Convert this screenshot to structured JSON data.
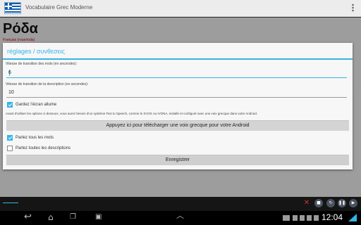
{
  "app": {
    "title": "Vocabulaire Grec Moderne",
    "word": "Ρόδα",
    "translation": "Français (roue/roda)"
  },
  "dialog": {
    "title": "réglages / συνθεσεις",
    "word_delay_label": "Vitesse de transition des mots (en secondes):",
    "word_delay_value": "6",
    "desc_delay_label": "Vitesse de transition de la description (en secondes):",
    "desc_delay_value": "10",
    "screen_on_label": "Gardez l'écran allume",
    "screen_on_checked": true,
    "info_text": "Avant d'utiliser les options ci-dessous, vous aurez besoin d'un système Text to Speech, comme le SVOX ou IVONA, installé et configuré avec une voix grecque dans votre Android.",
    "download_button": "Appuyez ici pour télécharger une voix grecque pour votre Android",
    "speak_words_label": "Parlez tous les mots",
    "speak_words_checked": true,
    "speak_desc_label": "Parlez toutes les descriptions",
    "speak_desc_checked": false,
    "save_button": "Enregistrer"
  },
  "status": {
    "time": "12:04"
  },
  "colors": {
    "accent": "#33b5e5",
    "translation": "#cc0000"
  },
  "icons": [
    "greek-flag-icon",
    "overflow-menu-icon",
    "back-icon",
    "home-icon",
    "recent-apps-icon",
    "screenshot-icon",
    "up-arrow-icon",
    "keyboard-icon",
    "play-icon",
    "pause-icon",
    "wifi-icon"
  ]
}
